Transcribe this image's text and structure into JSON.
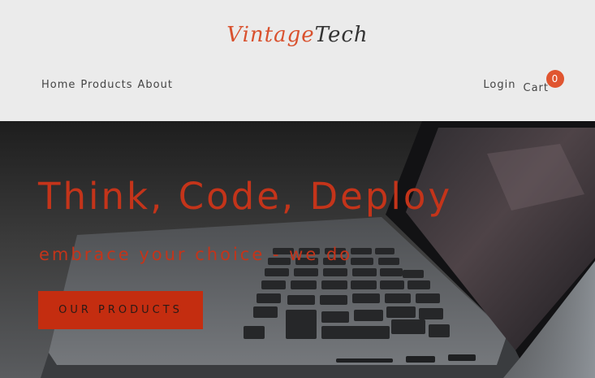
{
  "brand": {
    "part1": "Vintage",
    "part2": "Tech"
  },
  "nav": {
    "home": "Home",
    "products": "Products",
    "about": "About",
    "login": "Login",
    "cart": "Cart",
    "cart_count": "0"
  },
  "hero": {
    "title": "Think, Code, Deploy",
    "subtitle": "embrace your choice - we do",
    "cta": "OUR PRODUCTS"
  },
  "colors": {
    "accent": "#d9512e",
    "hero_text": "#c4341a",
    "button": "#c42d10",
    "header_bg": "#ebebeb"
  }
}
